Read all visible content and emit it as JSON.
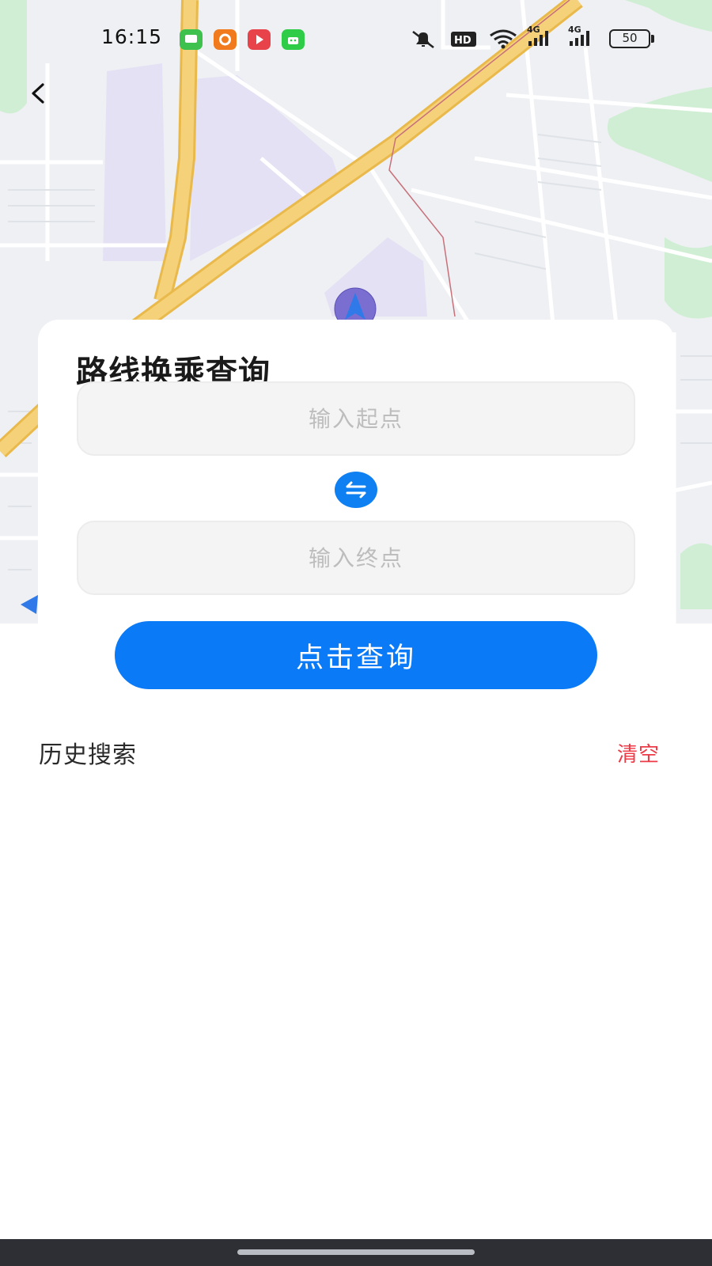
{
  "status_bar": {
    "time": "16:15",
    "notification_icons": [
      "messages-icon",
      "photo-app-icon",
      "video-player-icon",
      "android-app-icon"
    ],
    "system_icons": [
      "mute-icon",
      "hd-voice-icon",
      "wifi-icon",
      "signal-4g-icon",
      "signal-4g-icon"
    ],
    "hd_label": "HD",
    "network_label": "4G",
    "battery_level": "50"
  },
  "header": {
    "back_icon": "chevron-left-icon"
  },
  "route_card": {
    "title": "路线换乘查询",
    "start_placeholder": "输入起点",
    "start_value": "",
    "end_placeholder": "输入终点",
    "end_value": "",
    "swap_icon": "swap-arrows-icon"
  },
  "query_button_label": "点击查询",
  "history": {
    "title": "历史搜索",
    "clear_label": "清空",
    "items": []
  },
  "colors": {
    "accent_blue": "#0a7af6",
    "clear_red": "#ee3a46",
    "map_road_yellow": "#f5d27a",
    "map_block_purple": "#e4e1f5",
    "map_green": "#cfeed3"
  }
}
